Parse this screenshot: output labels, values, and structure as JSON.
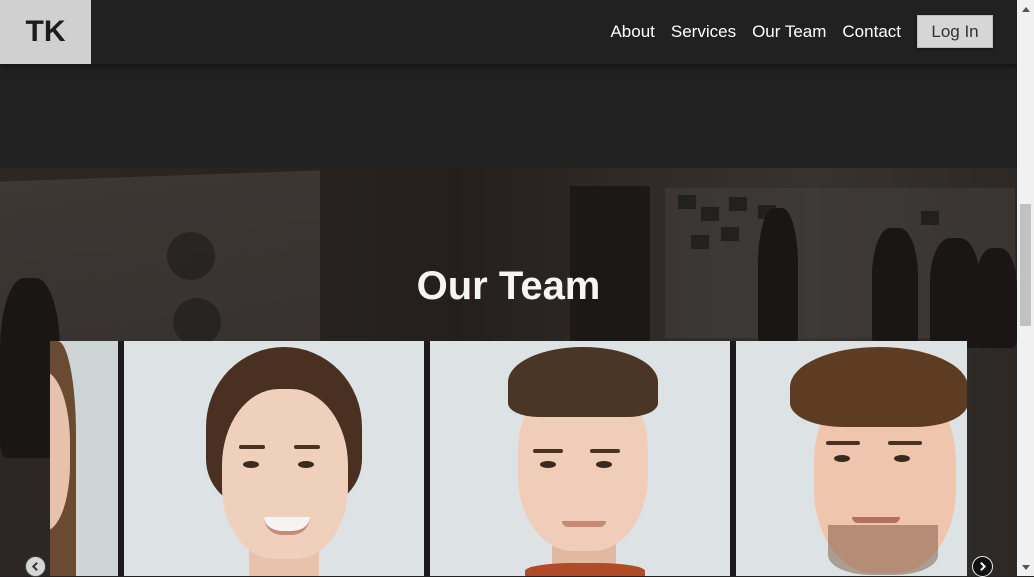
{
  "header": {
    "logo": "TK",
    "nav": [
      {
        "label": "About"
      },
      {
        "label": "Services"
      },
      {
        "label": "Our Team"
      },
      {
        "label": "Contact"
      }
    ],
    "login_label": "Log In"
  },
  "team": {
    "title": "Our Team"
  },
  "icons": {
    "prev": "chevron-left-icon",
    "next": "chevron-right-icon"
  },
  "colors": {
    "header_bg": "#212121",
    "logo_bg": "#d0d0d0",
    "login_bg": "#d6d6d6",
    "card_bg": "#dde3e4"
  }
}
